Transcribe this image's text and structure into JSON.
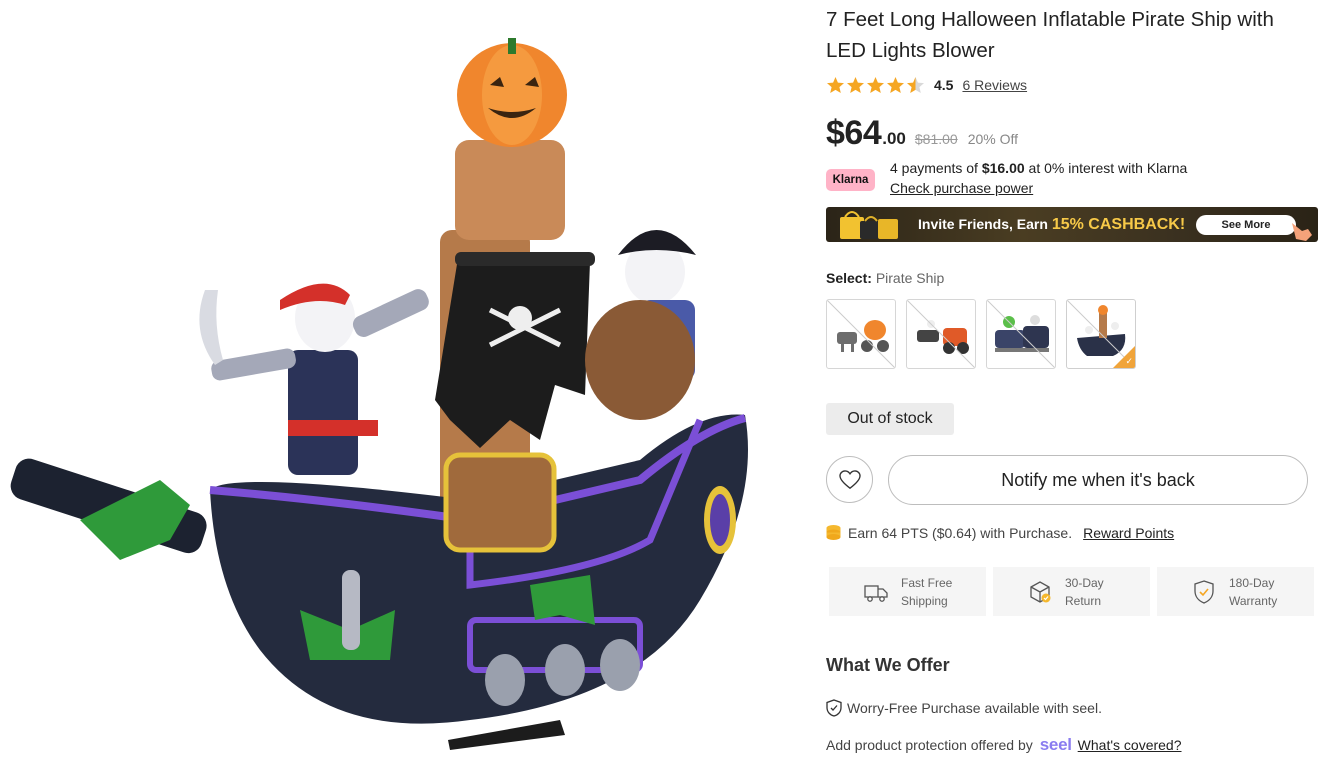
{
  "product": {
    "title": "7 Feet Long Halloween Inflatable Pirate Ship with LED Lights Blower",
    "rating": "4.5",
    "rating_value": 4.5,
    "rating_max": 5,
    "reviews_label": "6 Reviews",
    "price_main": "$64",
    "price_cents": ".00",
    "price_original": "$81.00",
    "discount": "20% Off"
  },
  "klarna": {
    "badge": "Klarna",
    "line_prefix": "4 payments of ",
    "amount": "$16.00",
    "line_suffix": " at 0% interest with Klarna",
    "link": "Check purchase power"
  },
  "banner": {
    "text_prefix": "Invite Friends, Earn ",
    "highlight": "15% CASHBACK!",
    "button": "See More"
  },
  "variant_select": {
    "label": "Select:",
    "value": "Pirate Ship",
    "options": [
      "Pumpkin Carriage",
      "Skeleton Carriage",
      "Haunted Train",
      "Pirate Ship"
    ],
    "selected_index": 3
  },
  "stock_status": "Out of stock",
  "notify_label": "Notify me when it's back",
  "points": {
    "text": "Earn 64 PTS ($0.64) with Purchase.",
    "link": "Reward Points"
  },
  "perks": [
    {
      "line1": "Fast Free",
      "line2": "Shipping",
      "icon": "truck-icon"
    },
    {
      "line1": "30-Day",
      "line2": "Return",
      "icon": "return-box-icon"
    },
    {
      "line1": "180-Day",
      "line2": "Warranty",
      "icon": "shield-check-icon"
    }
  ],
  "offer": {
    "title": "What We Offer",
    "worry_free": "Worry-Free Purchase available with seel.",
    "protection_text": "Add product protection offered by",
    "brand": "seel",
    "covered_link": "What's covered?"
  },
  "colors": {
    "star": "#f5a623",
    "klarna_pink": "#ffb3c7",
    "cashback_gold": "#f7c948",
    "selected_check": "#f0a43a",
    "seel_purple": "#8a7cf0"
  }
}
